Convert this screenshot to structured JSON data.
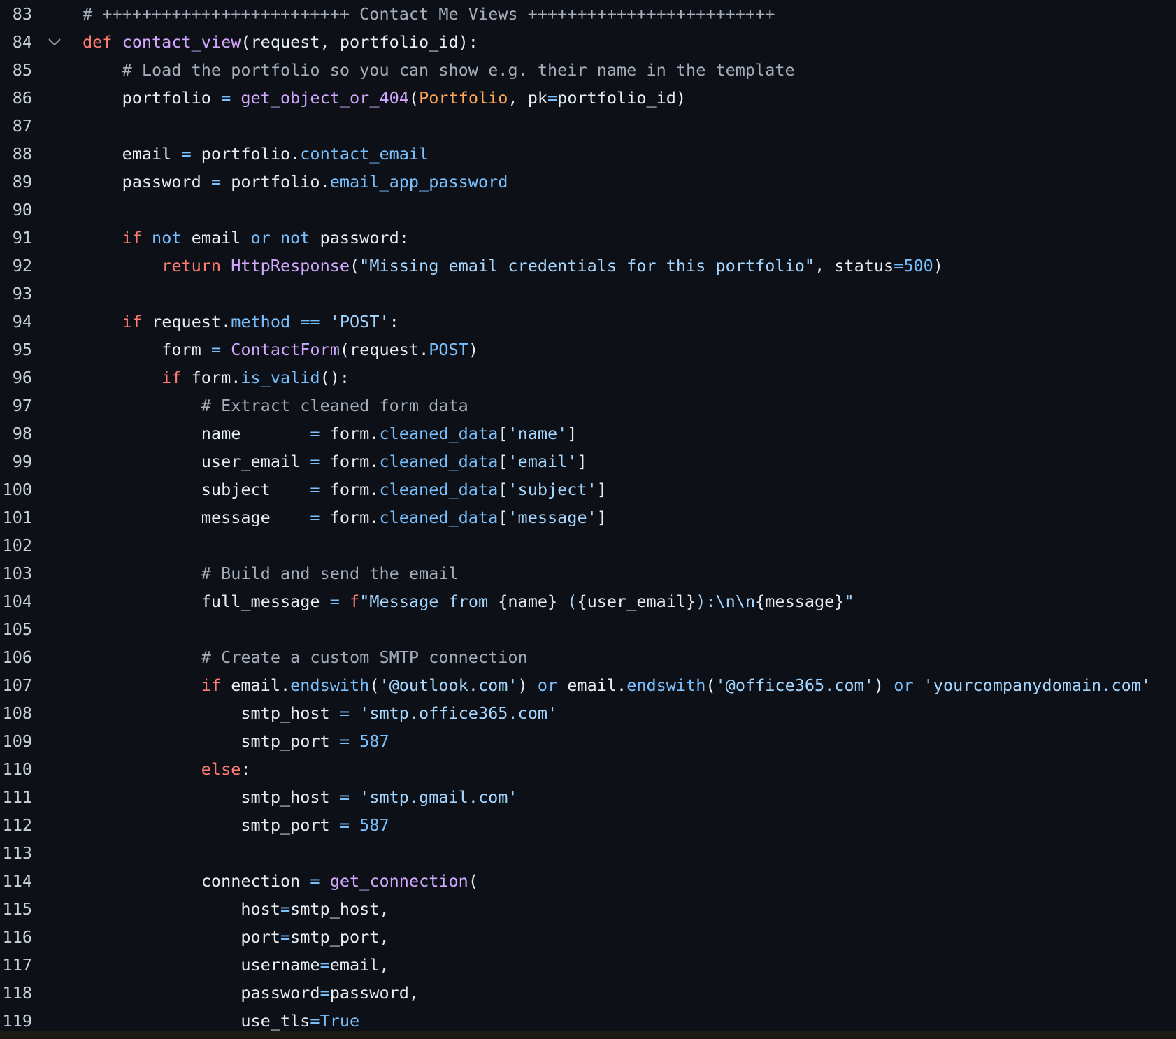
{
  "lines": [
    {
      "num": "83",
      "segments": [
        {
          "cls": "tok-comment",
          "text": "# +++++++++++++++++++++++++ Contact Me Views +++++++++++++++++++++++++"
        }
      ]
    },
    {
      "num": "84",
      "fold": true,
      "segments": [
        {
          "cls": "tok-keyword",
          "text": "def "
        },
        {
          "cls": "tok-func",
          "text": "contact_view"
        },
        {
          "cls": "tok-plain",
          "text": "(request, portfolio_id):"
        }
      ]
    },
    {
      "num": "85",
      "segments": [
        {
          "cls": "tok-comment",
          "text": "    # Load the portfolio so you can show e.g. their name in the template"
        }
      ]
    },
    {
      "num": "86",
      "segments": [
        {
          "cls": "tok-plain",
          "text": "    portfolio "
        },
        {
          "cls": "tok-op",
          "text": "="
        },
        {
          "cls": "tok-plain",
          "text": " "
        },
        {
          "cls": "tok-func",
          "text": "get_object_or_404"
        },
        {
          "cls": "tok-plain",
          "text": "("
        },
        {
          "cls": "tok-class",
          "text": "Portfolio"
        },
        {
          "cls": "tok-plain",
          "text": ", pk"
        },
        {
          "cls": "tok-op",
          "text": "="
        },
        {
          "cls": "tok-plain",
          "text": "portfolio_id)"
        }
      ]
    },
    {
      "num": "87",
      "segments": []
    },
    {
      "num": "88",
      "segments": [
        {
          "cls": "tok-plain",
          "text": "    email "
        },
        {
          "cls": "tok-op",
          "text": "="
        },
        {
          "cls": "tok-plain",
          "text": " portfolio."
        },
        {
          "cls": "tok-attr",
          "text": "contact_email"
        }
      ]
    },
    {
      "num": "89",
      "segments": [
        {
          "cls": "tok-plain",
          "text": "    password "
        },
        {
          "cls": "tok-op",
          "text": "="
        },
        {
          "cls": "tok-plain",
          "text": " portfolio."
        },
        {
          "cls": "tok-attr",
          "text": "email_app_password"
        }
      ]
    },
    {
      "num": "90",
      "segments": []
    },
    {
      "num": "91",
      "segments": [
        {
          "cls": "tok-keyword",
          "text": "    if "
        },
        {
          "cls": "tok-builtin",
          "text": "not"
        },
        {
          "cls": "tok-plain",
          "text": " email "
        },
        {
          "cls": "tok-builtin",
          "text": "or not"
        },
        {
          "cls": "tok-plain",
          "text": " password:"
        }
      ]
    },
    {
      "num": "92",
      "segments": [
        {
          "cls": "tok-keyword",
          "text": "        return "
        },
        {
          "cls": "tok-func",
          "text": "HttpResponse"
        },
        {
          "cls": "tok-plain",
          "text": "("
        },
        {
          "cls": "tok-string",
          "text": "\"Missing email credentials for this portfolio\""
        },
        {
          "cls": "tok-plain",
          "text": ", status"
        },
        {
          "cls": "tok-op",
          "text": "="
        },
        {
          "cls": "tok-number",
          "text": "500"
        },
        {
          "cls": "tok-plain",
          "text": ")"
        }
      ]
    },
    {
      "num": "93",
      "segments": []
    },
    {
      "num": "94",
      "segments": [
        {
          "cls": "tok-keyword",
          "text": "    if "
        },
        {
          "cls": "tok-plain",
          "text": "request."
        },
        {
          "cls": "tok-attr",
          "text": "method"
        },
        {
          "cls": "tok-plain",
          "text": " "
        },
        {
          "cls": "tok-op",
          "text": "=="
        },
        {
          "cls": "tok-plain",
          "text": " "
        },
        {
          "cls": "tok-string",
          "text": "'POST'"
        },
        {
          "cls": "tok-plain",
          "text": ":"
        }
      ]
    },
    {
      "num": "95",
      "segments": [
        {
          "cls": "tok-plain",
          "text": "        form "
        },
        {
          "cls": "tok-op",
          "text": "="
        },
        {
          "cls": "tok-plain",
          "text": " "
        },
        {
          "cls": "tok-func",
          "text": "ContactForm"
        },
        {
          "cls": "tok-plain",
          "text": "(request."
        },
        {
          "cls": "tok-attr",
          "text": "POST"
        },
        {
          "cls": "tok-plain",
          "text": ")"
        }
      ]
    },
    {
      "num": "96",
      "segments": [
        {
          "cls": "tok-keyword",
          "text": "        if "
        },
        {
          "cls": "tok-plain",
          "text": "form."
        },
        {
          "cls": "tok-attr",
          "text": "is_valid"
        },
        {
          "cls": "tok-plain",
          "text": "():"
        }
      ]
    },
    {
      "num": "97",
      "segments": [
        {
          "cls": "tok-comment",
          "text": "            # Extract cleaned form data"
        }
      ]
    },
    {
      "num": "98",
      "segments": [
        {
          "cls": "tok-plain",
          "text": "            name       "
        },
        {
          "cls": "tok-op",
          "text": "="
        },
        {
          "cls": "tok-plain",
          "text": " form."
        },
        {
          "cls": "tok-attr",
          "text": "cleaned_data"
        },
        {
          "cls": "tok-plain",
          "text": "["
        },
        {
          "cls": "tok-string",
          "text": "'name'"
        },
        {
          "cls": "tok-plain",
          "text": "]"
        }
      ]
    },
    {
      "num": "99",
      "segments": [
        {
          "cls": "tok-plain",
          "text": "            user_email "
        },
        {
          "cls": "tok-op",
          "text": "="
        },
        {
          "cls": "tok-plain",
          "text": " form."
        },
        {
          "cls": "tok-attr",
          "text": "cleaned_data"
        },
        {
          "cls": "tok-plain",
          "text": "["
        },
        {
          "cls": "tok-string",
          "text": "'email'"
        },
        {
          "cls": "tok-plain",
          "text": "]"
        }
      ]
    },
    {
      "num": "100",
      "segments": [
        {
          "cls": "tok-plain",
          "text": "            subject    "
        },
        {
          "cls": "tok-op",
          "text": "="
        },
        {
          "cls": "tok-plain",
          "text": " form."
        },
        {
          "cls": "tok-attr",
          "text": "cleaned_data"
        },
        {
          "cls": "tok-plain",
          "text": "["
        },
        {
          "cls": "tok-string",
          "text": "'subject'"
        },
        {
          "cls": "tok-plain",
          "text": "]"
        }
      ]
    },
    {
      "num": "101",
      "segments": [
        {
          "cls": "tok-plain",
          "text": "            message    "
        },
        {
          "cls": "tok-op",
          "text": "="
        },
        {
          "cls": "tok-plain",
          "text": " form."
        },
        {
          "cls": "tok-attr",
          "text": "cleaned_data"
        },
        {
          "cls": "tok-plain",
          "text": "["
        },
        {
          "cls": "tok-string",
          "text": "'message'"
        },
        {
          "cls": "tok-plain",
          "text": "]"
        }
      ]
    },
    {
      "num": "102",
      "segments": []
    },
    {
      "num": "103",
      "segments": [
        {
          "cls": "tok-comment",
          "text": "            # Build and send the email"
        }
      ]
    },
    {
      "num": "104",
      "segments": [
        {
          "cls": "tok-plain",
          "text": "            full_message "
        },
        {
          "cls": "tok-op",
          "text": "="
        },
        {
          "cls": "tok-plain",
          "text": " "
        },
        {
          "cls": "tok-keyword",
          "text": "f"
        },
        {
          "cls": "tok-string",
          "text": "\"Message from "
        },
        {
          "cls": "tok-plain",
          "text": "{name}"
        },
        {
          "cls": "tok-string",
          "text": " ("
        },
        {
          "cls": "tok-plain",
          "text": "{user_email}"
        },
        {
          "cls": "tok-string",
          "text": "):\\n\\n"
        },
        {
          "cls": "tok-plain",
          "text": "{message}"
        },
        {
          "cls": "tok-string",
          "text": "\""
        }
      ]
    },
    {
      "num": "105",
      "segments": []
    },
    {
      "num": "106",
      "segments": [
        {
          "cls": "tok-comment",
          "text": "            # Create a custom SMTP connection"
        }
      ]
    },
    {
      "num": "107",
      "segments": [
        {
          "cls": "tok-keyword",
          "text": "            if "
        },
        {
          "cls": "tok-plain",
          "text": "email."
        },
        {
          "cls": "tok-attr",
          "text": "endswith"
        },
        {
          "cls": "tok-plain",
          "text": "("
        },
        {
          "cls": "tok-string",
          "text": "'@outlook.com'"
        },
        {
          "cls": "tok-plain",
          "text": ") "
        },
        {
          "cls": "tok-builtin",
          "text": "or"
        },
        {
          "cls": "tok-plain",
          "text": " email."
        },
        {
          "cls": "tok-attr",
          "text": "endswith"
        },
        {
          "cls": "tok-plain",
          "text": "("
        },
        {
          "cls": "tok-string",
          "text": "'@office365.com'"
        },
        {
          "cls": "tok-plain",
          "text": ") "
        },
        {
          "cls": "tok-builtin",
          "text": "or"
        },
        {
          "cls": "tok-plain",
          "text": " "
        },
        {
          "cls": "tok-string",
          "text": "'yourcompanydomain.com'"
        }
      ]
    },
    {
      "num": "108",
      "segments": [
        {
          "cls": "tok-plain",
          "text": "                smtp_host "
        },
        {
          "cls": "tok-op",
          "text": "="
        },
        {
          "cls": "tok-plain",
          "text": " "
        },
        {
          "cls": "tok-string",
          "text": "'smtp.office365.com'"
        }
      ]
    },
    {
      "num": "109",
      "segments": [
        {
          "cls": "tok-plain",
          "text": "                smtp_port "
        },
        {
          "cls": "tok-op",
          "text": "="
        },
        {
          "cls": "tok-plain",
          "text": " "
        },
        {
          "cls": "tok-number",
          "text": "587"
        }
      ]
    },
    {
      "num": "110",
      "segments": [
        {
          "cls": "tok-keyword",
          "text": "            else"
        },
        {
          "cls": "tok-plain",
          "text": ":"
        }
      ]
    },
    {
      "num": "111",
      "segments": [
        {
          "cls": "tok-plain",
          "text": "                smtp_host "
        },
        {
          "cls": "tok-op",
          "text": "="
        },
        {
          "cls": "tok-plain",
          "text": " "
        },
        {
          "cls": "tok-string",
          "text": "'smtp.gmail.com'"
        }
      ]
    },
    {
      "num": "112",
      "segments": [
        {
          "cls": "tok-plain",
          "text": "                smtp_port "
        },
        {
          "cls": "tok-op",
          "text": "="
        },
        {
          "cls": "tok-plain",
          "text": " "
        },
        {
          "cls": "tok-number",
          "text": "587"
        }
      ]
    },
    {
      "num": "113",
      "segments": []
    },
    {
      "num": "114",
      "segments": [
        {
          "cls": "tok-plain",
          "text": "            connection "
        },
        {
          "cls": "tok-op",
          "text": "="
        },
        {
          "cls": "tok-plain",
          "text": " "
        },
        {
          "cls": "tok-func",
          "text": "get_connection"
        },
        {
          "cls": "tok-plain",
          "text": "("
        }
      ]
    },
    {
      "num": "115",
      "segments": [
        {
          "cls": "tok-plain",
          "text": "                host"
        },
        {
          "cls": "tok-op",
          "text": "="
        },
        {
          "cls": "tok-plain",
          "text": "smtp_host,"
        }
      ]
    },
    {
      "num": "116",
      "segments": [
        {
          "cls": "tok-plain",
          "text": "                port"
        },
        {
          "cls": "tok-op",
          "text": "="
        },
        {
          "cls": "tok-plain",
          "text": "smtp_port,"
        }
      ]
    },
    {
      "num": "117",
      "segments": [
        {
          "cls": "tok-plain",
          "text": "                username"
        },
        {
          "cls": "tok-op",
          "text": "="
        },
        {
          "cls": "tok-plain",
          "text": "email,"
        }
      ]
    },
    {
      "num": "118",
      "segments": [
        {
          "cls": "tok-plain",
          "text": "                password"
        },
        {
          "cls": "tok-op",
          "text": "="
        },
        {
          "cls": "tok-plain",
          "text": "password,"
        }
      ]
    },
    {
      "num": "119",
      "segments": [
        {
          "cls": "tok-plain",
          "text": "                use_tls"
        },
        {
          "cls": "tok-op",
          "text": "="
        },
        {
          "cls": "tok-builtin",
          "text": "True"
        }
      ]
    }
  ]
}
